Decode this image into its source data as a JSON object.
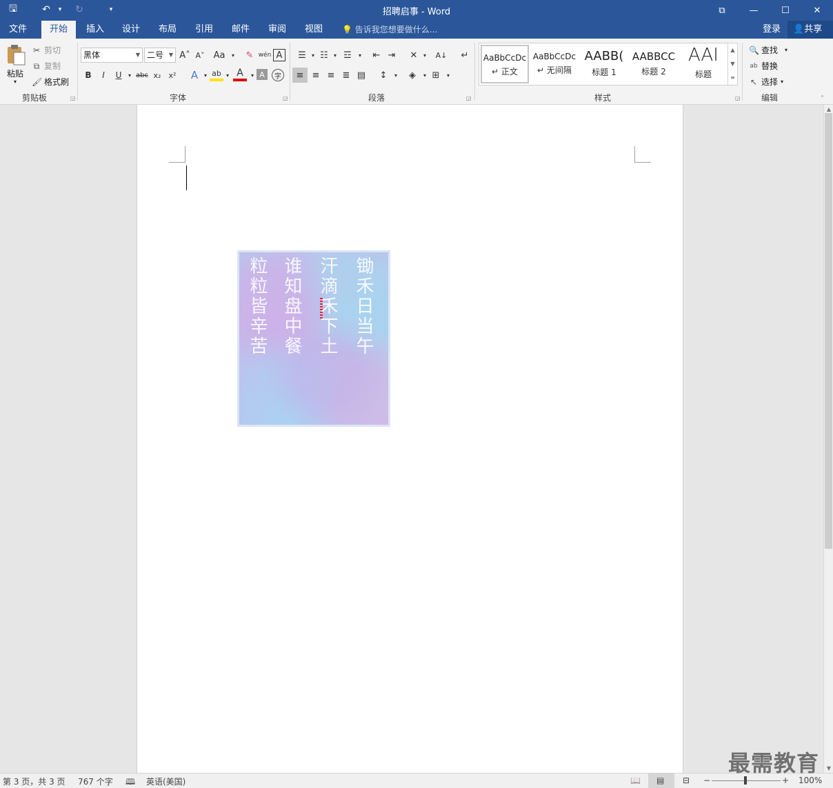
{
  "window": {
    "title": "招聘启事 - Word"
  },
  "qat": {
    "save": "🖫",
    "undo": "↶",
    "redo": "↻",
    "customize": "⯆"
  },
  "window_controls": {
    "restore_ribbon": "⧉",
    "minimize": "—",
    "maximize": "☐",
    "close": "✕"
  },
  "tabs": [
    "文件",
    "开始",
    "插入",
    "设计",
    "布局",
    "引用",
    "邮件",
    "审阅",
    "视图"
  ],
  "active_tab": "开始",
  "tellme": "告诉我您想要做什么...",
  "account": {
    "login": "登录",
    "share": "共享"
  },
  "clipboard": {
    "paste": "粘贴",
    "cut": "剪切",
    "copy": "复制",
    "format_painter": "格式刷",
    "group": "剪贴板"
  },
  "font": {
    "name": "黑体",
    "size": "二号",
    "group": "字体",
    "buttons": {
      "grow": "A˄",
      "shrink": "A˅",
      "case": "Aa",
      "clear": "✎",
      "phonetic": "wén",
      "border": "A",
      "bold": "B",
      "italic": "I",
      "underline": "U",
      "strike": "abc",
      "sub": "x₂",
      "sup": "x²",
      "effects": "A",
      "highlight": "ab",
      "color": "A",
      "shade": "A",
      "enclose": "字"
    }
  },
  "paragraph": {
    "group": "段落"
  },
  "styles": {
    "group": "样式",
    "items": [
      {
        "preview": "AaBbCcDc",
        "name": "正文"
      },
      {
        "preview": "AaBbCcDc",
        "name": "无间隔"
      },
      {
        "preview": "AABB(",
        "name": "标题 1"
      },
      {
        "preview": "AABBCC",
        "name": "标题 2"
      },
      {
        "preview": "AAI",
        "name": "标题"
      }
    ]
  },
  "editing": {
    "group": "编辑",
    "find": "查找",
    "replace": "替换",
    "select": "选择"
  },
  "poem": {
    "columns": [
      "锄禾日当午",
      "汗滴禾下土",
      "谁知盘中餐",
      "粒粒皆辛苦"
    ]
  },
  "status": {
    "page": "第 3 页，共 3 页",
    "words": "767 个字",
    "language": "英语(美国)",
    "zoom": "100%"
  },
  "watermark": "最需教育",
  "colors": {
    "accent": "#2b579a"
  }
}
